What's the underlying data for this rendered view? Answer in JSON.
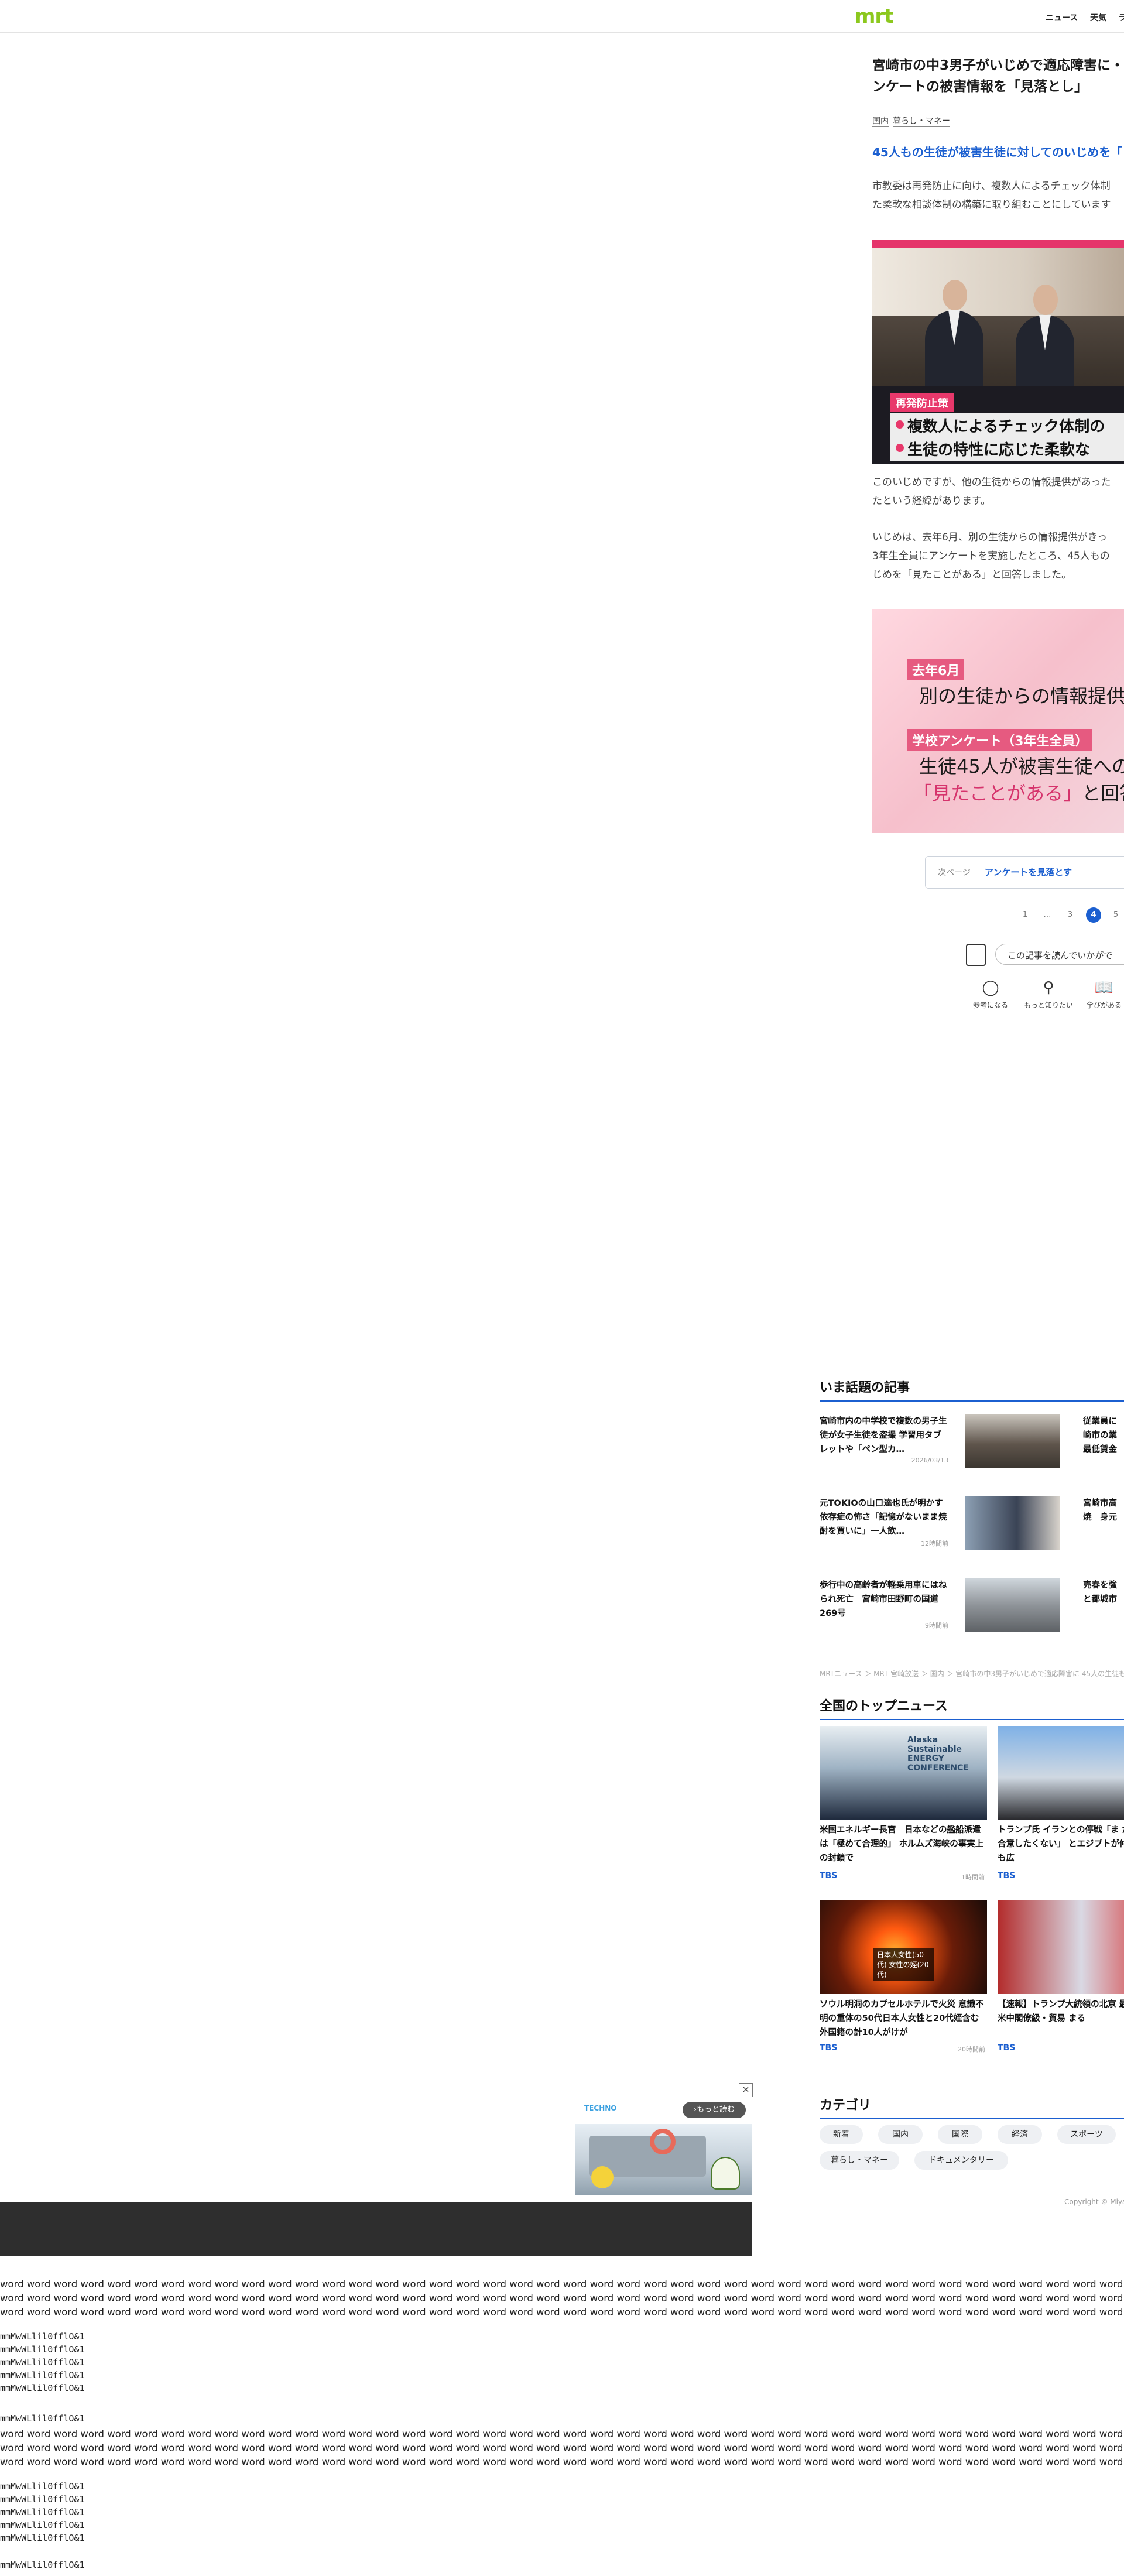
{
  "header": {
    "logo": "mrt",
    "nav": [
      "ニュース",
      "天気",
      "ラ"
    ]
  },
  "article": {
    "title_line1": "宮崎市の中3男子がいじめで適応障害に・",
    "title_line2": "ンケートの被害情報を「見落とし」",
    "tags": [
      "国内",
      "暮らし・マネー"
    ],
    "lead": "45人もの生徒が被害生徒に対してのいじめを「",
    "para1": [
      "市教委は再発防止に向け、複数人によるチェック体制",
      "た柔軟な相談体制の構築に取り組むことにしています"
    ],
    "photo1": {
      "label": "再発防止策",
      "line1": "複数人によるチェック体制の",
      "line2": "生徒の特性に応じた柔軟な"
    },
    "para2": [
      "このいじめですが、他の生徒からの情報提供があった",
      "たという経緯があります。"
    ],
    "para3": [
      "いじめは、去年6月、別の生徒からの情報提供がきっ",
      "3年生全員にアンケートを実施したところ、45人もの",
      "じめを「見たことがある」と回答しました。"
    ],
    "photo2": {
      "label1": "去年6月",
      "text1": "別の生徒からの情報提供",
      "label2": "学校アンケート（3年生全員）",
      "text2": "生徒45人が被害生徒への",
      "text3_hl": "「見たことがある」",
      "text3": "と回答"
    }
  },
  "next_page": {
    "label": "次ページ",
    "title": "アンケートを見落とす"
  },
  "pagination": [
    "1",
    "…",
    "3",
    "4",
    "5"
  ],
  "feedback": {
    "question": "この記事を読んでいかがで",
    "reactions": [
      "参考になる",
      "もっと知りたい",
      "学びがある"
    ]
  },
  "trending": {
    "heading": "いま話題の記事",
    "items": [
      {
        "title": "宮崎市内の中学校で複数の男子生徒が女子生徒を盗撮 学習用タブレットや「ペン型カ…",
        "time": "2026/03/13"
      },
      {
        "title": "元TOKIOの山口達也氏が明かす依存症の怖さ「記憶がないまま焼酎を買いに」一人飲…",
        "time": "12時間前"
      },
      {
        "title": "歩行中の高齢者が軽乗用車にはねられ死亡　宮崎市田野町の国道269号",
        "time": "9時間前"
      }
    ],
    "side": [
      [
        "従業員に",
        "崎市の業",
        "最低賃金"
      ],
      [
        "宮崎市高",
        "焼　身元"
      ],
      [
        "売春を強",
        "と都城市"
      ]
    ]
  },
  "breadcrumb": "MRTニュース ＞ MRT 宮崎放送 ＞ 国内 ＞ 宮崎市の中3男子がいじめで適応障害に 45人の生徒も…",
  "top_news": {
    "heading": "全国のトップニュース",
    "items": [
      {
        "title": "米国エネルギー長官　日本などの艦船派遣は「極めて合理的」 ホルムズ海峡の事実上の封鎖で",
        "src": "TBS",
        "time": "1時間前"
      },
      {
        "title": "トランプ氏 イランとの停戦「ま だ不十分で合意したくない」 とエジプトが仲介試みるも広",
        "src": "TBS",
        "time": ""
      },
      {
        "title": "ソウル明洞のカプセルホテルで火災 意識不明の重体の50代日本人女性と20代姪含む外国籍の計10人がけが",
        "src": "TBS",
        "time": "20時間前"
      },
      {
        "title": "【速報】トランプ大統領の北京 最終調整　米中閣僚級・貿易 まる",
        "src": "TBS",
        "time": ""
      }
    ],
    "img_caption_1": "Alaska Sustainable ENERGY CONFERENCE",
    "img_caption_3": "日本人女性(50代) 女性の姪(20代)"
  },
  "categories": {
    "heading": "カテゴリ",
    "items": [
      "新着",
      "国内",
      "国際",
      "経済",
      "スポーツ",
      "暮らし・マネー",
      "ドキュメンタリー"
    ]
  },
  "copyright": "Copyright © Miya",
  "ad": {
    "close": "×",
    "more": "›もっと読む",
    "brand": "TECHNO"
  },
  "filler": {
    "word_line_long": "word word word word word word word word word word word word word word word word word word word word word word word word word word word word word word word word word word word word word word word word word word word word word word word word word word word word word word word word word word word word word word word word word word word word word word word word word word word word word word word word word word word word word word word word",
    "word_line_short": "word word word word word word word word word word word word word word word word word word word word word word word word word word word word word word word word word word word word word word word word word word word",
    "mono": [
      "mmMwWLlil0fflO&1",
      "mmMwWLlil0fflO&1",
      "mmMwWLlil0fflO&1",
      "mmMwWLlil0fflO&1",
      "mmMwWLlil0fflO&1"
    ]
  },
  "colors": {
    "accent": "#1b5fd0",
    "brand": "#8cc81e",
    "highlight": "#e8386b"
  }
}
